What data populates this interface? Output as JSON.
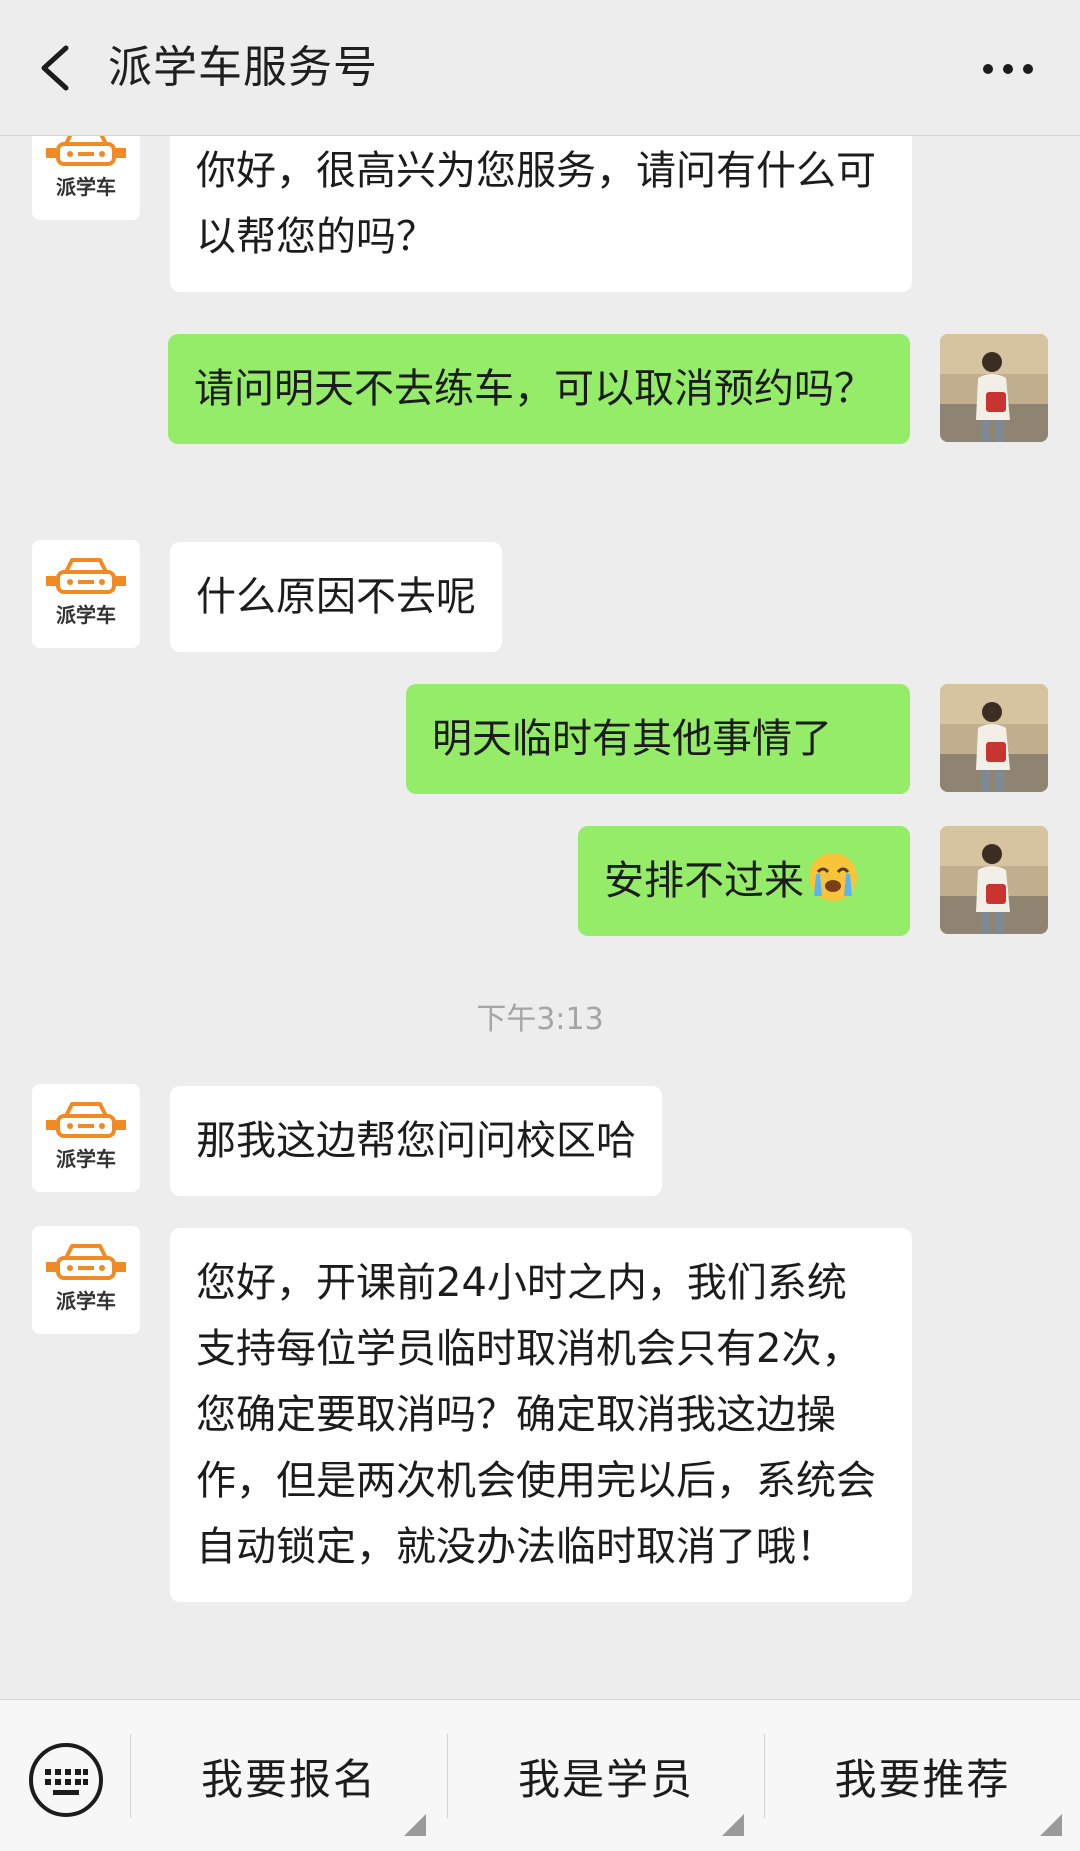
{
  "header": {
    "title": "派学车服务号",
    "back_icon": "chevron-left-icon",
    "more_icon": "ellipsis-icon"
  },
  "brand": {
    "avatar_text": "派学车",
    "accent_color": "#f08a24"
  },
  "messages": [
    {
      "from": "service",
      "text": "你好，很高兴为您服务，请问有什么可以帮您的吗？"
    },
    {
      "from": "user",
      "text": "请问明天不去练车，可以取消预约吗？"
    },
    {
      "from": "service",
      "text": "什么原因不去呢"
    },
    {
      "from": "user",
      "text": "明天临时有其他事情了"
    },
    {
      "from": "user",
      "text": "安排不过来",
      "emoji": "loudly-crying-face-icon"
    },
    {
      "from": "service",
      "text": "那我这边帮您问问校区哈"
    },
    {
      "from": "service",
      "text": "您好，开课前24小时之内，我们系统支持每位学员临时取消机会只有2次，您确定要取消吗？确定取消我这边操作，但是两次机会使用完以后，系统会自动锁定，就没办法临时取消了哦！"
    }
  ],
  "timestamp": "下午3:13",
  "menu": {
    "keyboard_icon": "keyboard-icon",
    "items": [
      {
        "label": "我要报名"
      },
      {
        "label": "我是学员"
      },
      {
        "label": "我要推荐"
      }
    ]
  },
  "colors": {
    "bubble_out": "#95ec69",
    "bubble_in": "#ffffff",
    "background": "#ededed"
  }
}
